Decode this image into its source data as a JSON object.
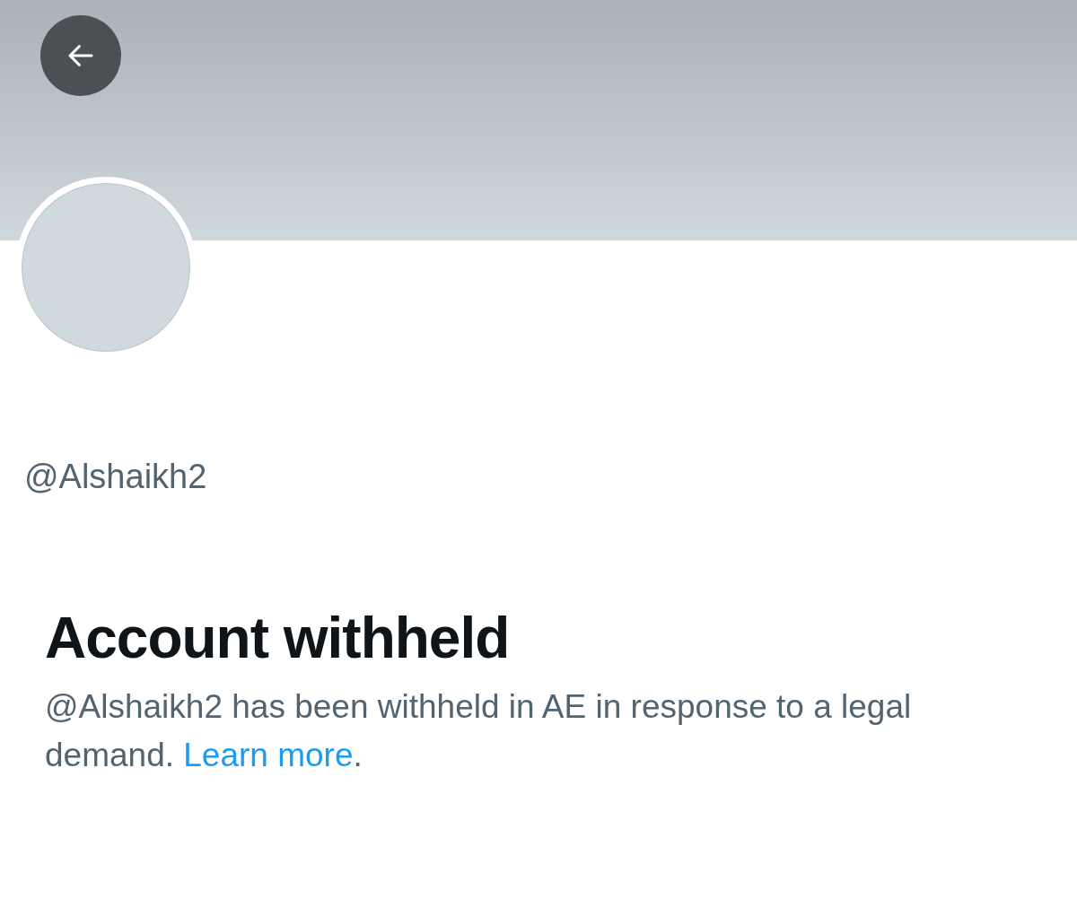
{
  "profile": {
    "handle": "@Alshaikh2"
  },
  "notice": {
    "title": "Account withheld",
    "message": "@Alshaikh2 has been withheld in AE in response to a legal demand. ",
    "link": "Learn more",
    "message_end": "."
  }
}
